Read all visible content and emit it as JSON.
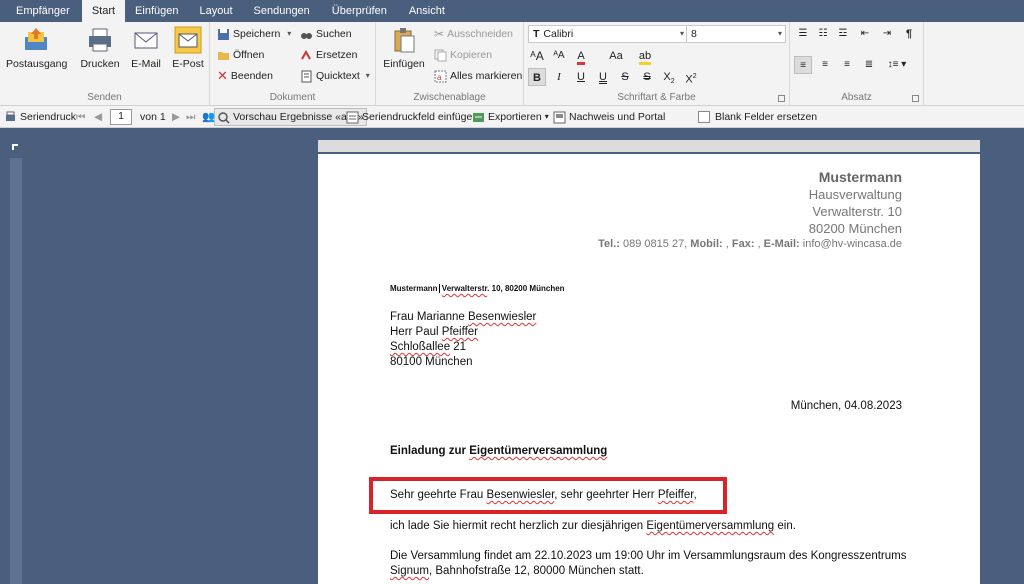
{
  "tabs": [
    "Empfänger",
    "Start",
    "Einfügen",
    "Layout",
    "Sendungen",
    "Überprüfen",
    "Ansicht"
  ],
  "ribbon": {
    "senden": {
      "label": "Senden",
      "postausgang": "Postausgang",
      "drucken": "Drucken",
      "email": "E-Mail",
      "epost": "E-Post"
    },
    "dokument": {
      "label": "Dokument",
      "speichern": "Speichern",
      "oeffnen": "Öffnen",
      "beenden": "Beenden",
      "suchen": "Suchen",
      "ersetzen": "Ersetzen",
      "quicktext": "Quicktext"
    },
    "zwischenablage": {
      "label": "Zwischenablage",
      "einfuegen": "Einfügen",
      "ausschneiden": "Ausschneiden",
      "kopieren": "Kopieren",
      "alles_markieren": "Alles markieren"
    },
    "schrift": {
      "label": "Schriftart & Farbe",
      "font": "Calibri",
      "size": "8"
    },
    "absatz": {
      "label": "Absatz"
    }
  },
  "mailmerge": {
    "seriendruck": "Seriendruck",
    "page": "1",
    "of": "von 1",
    "vorschau": "Vorschau Ergebnisse «abc»",
    "feld": "Seriendruckfeld einfügen",
    "exportieren": "Exportieren",
    "nachweis": "Nachweis und Portal",
    "blank": "Blank Felder ersetzen"
  },
  "letter": {
    "company": "Mustermann",
    "sub": "Hausverwaltung",
    "street": "Verwalterstr. 10",
    "city": "80200 München",
    "tel_label": "Tel.:",
    "tel": " 089 0815 27, ",
    "mobil_label": "Mobil:",
    "mobil": " , ",
    "fax_label": "Fax:",
    "fax": " , ",
    "email_label": "E-Mail:",
    "email": " info@hv-wincasa.de",
    "return_a": "Mustermann",
    "return_b": "Verwalterstr",
    "return_c": ". 10, 80200 München",
    "r1a": "Frau Marianne ",
    "r1b": "Besenwiesler",
    "r2a": "Herr Paul ",
    "r2b": "Pfeiffer",
    "r3a": "Schloßallee",
    "r3b": " 21",
    "r4": "80100 München",
    "date": "München, 04.08.2023",
    "subject_a": "Einladung zur ",
    "subject_b": "Eigentümerversammlung",
    "greet_a": "Sehr geehrte Frau ",
    "greet_b": "Besenwiesler",
    "greet_c": ", sehr geehrter Herr ",
    "greet_d": "Pfeiffer",
    "greet_e": ",",
    "body1_a": "ich lade Sie hiermit recht herzlich zur diesjährigen ",
    "body1_b": "Eigentümerversammlung",
    "body1_c": " ein.",
    "body2": "Die Versammlung findet am 22.10.2023 um 19:00 Uhr im Versammlungsraum des Kongresszentrums",
    "body3_a": "Signum",
    "body3_b": ", Bahnhofstraße 12, 80000 München statt."
  }
}
